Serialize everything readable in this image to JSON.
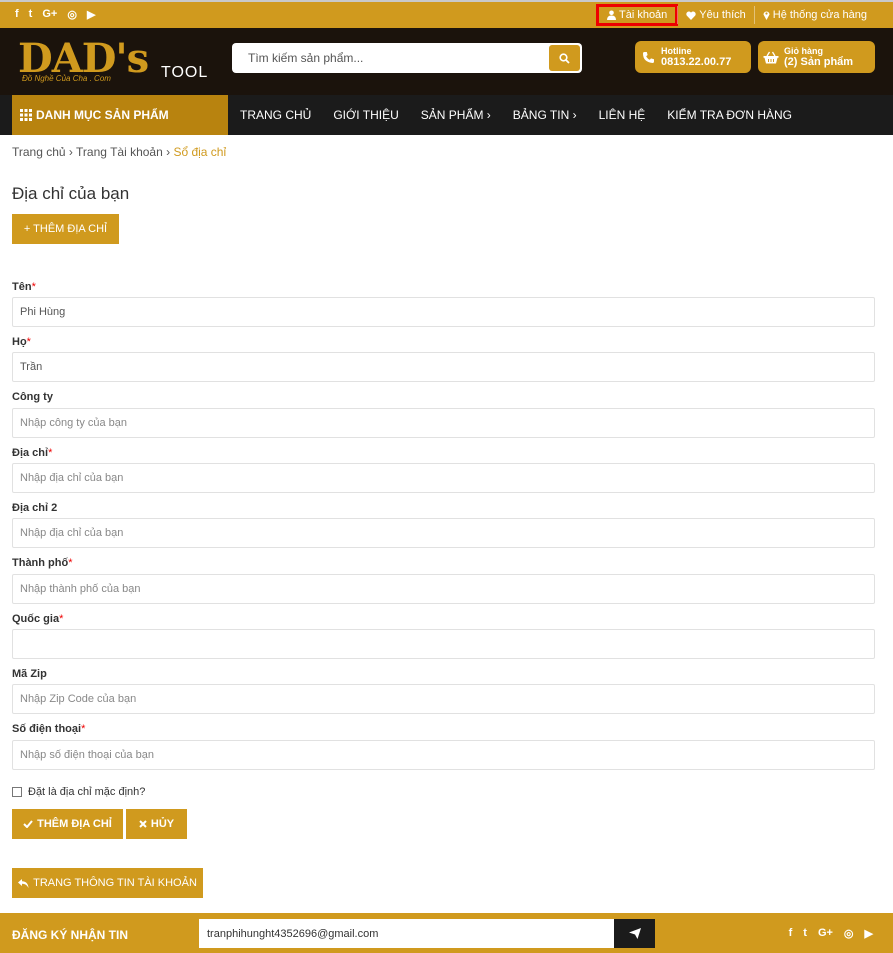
{
  "topbar": {
    "social_icons": [
      "f",
      "t",
      "G+",
      "◎",
      "▶"
    ],
    "links": [
      {
        "label": "Tài khoản",
        "icon": "user-icon"
      },
      {
        "label": "Yêu thích",
        "icon": "heart-icon"
      },
      {
        "label": "Hệ thống cửa hàng",
        "icon": "map-marker-icon"
      }
    ]
  },
  "header": {
    "logo": {
      "main": "DAD's",
      "sub": "TOOL",
      "tagline": "Đồ Nghề Của Cha . Com"
    },
    "search_placeholder": "Tìm kiếm sản phẩm...",
    "hotline": {
      "label": "Hotline",
      "value": "0813.22.00.77"
    },
    "cart": {
      "label": "Giỏ hàng",
      "value": "(2) Sản phẩm"
    }
  },
  "nav": {
    "category_label": "DANH MỤC SẢN PHẨM",
    "items": [
      "TRANG CHỦ",
      "GIỚI THIỆU",
      "SẢN PHẨM ›",
      "BẢNG TIN ›",
      "LIÊN HỆ",
      "KIỂM TRA ĐƠN HÀNG"
    ]
  },
  "breadcrumb": {
    "home": "Trang chủ",
    "account": "Trang Tài khoản",
    "current": "Sổ địa chỉ",
    "sep": " › "
  },
  "page": {
    "title": "Địa chỉ của bạn",
    "add_button": "+ THÊM ĐỊA CHỈ"
  },
  "form": {
    "fields": [
      {
        "label": "Tên",
        "required": "*",
        "value": "Phi Hùng",
        "placeholder": ""
      },
      {
        "label": "Họ",
        "required": "*",
        "value": "Trần",
        "placeholder": ""
      },
      {
        "label": "Công ty",
        "required": "",
        "value": "",
        "placeholder": "Nhập công ty của bạn"
      },
      {
        "label": "Địa chỉ",
        "required": "*",
        "value": "",
        "placeholder": "Nhập địa chỉ của bạn"
      },
      {
        "label": "Địa chỉ 2",
        "required": "",
        "value": "",
        "placeholder": "Nhập địa chỉ của bạn"
      },
      {
        "label": "Thành phố",
        "required": "*",
        "value": "",
        "placeholder": "Nhập thành phố của bạn"
      },
      {
        "label": "Quốc gia",
        "required": "*",
        "value": "",
        "placeholder": ""
      },
      {
        "label": "Mã Zip",
        "required": "",
        "value": "",
        "placeholder": "Nhập Zip Code của bạn"
      },
      {
        "label": "Số điện thoại",
        "required": "*",
        "value": "",
        "placeholder": "Nhập số điện thoại của bạn"
      }
    ],
    "default_checkbox_label": "Đặt là địa chỉ mặc định?",
    "submit_label": "THÊM ĐỊA CHỈ",
    "cancel_label": "HỦY",
    "back_label": "TRANG THÔNG TIN TÀI KHOẢN"
  },
  "footer": {
    "newsletter_label": "ĐĂNG KÝ NHẬN TIN",
    "email_value": "tranphihunght4352696@gmail.com",
    "social_icons": [
      "f",
      "t",
      "G+",
      "◎",
      "▶"
    ]
  },
  "colors": {
    "accent": "#d09a1e",
    "dark": "#1b130c",
    "nav": "#1b1b1b",
    "highlight": "#ee0000"
  }
}
